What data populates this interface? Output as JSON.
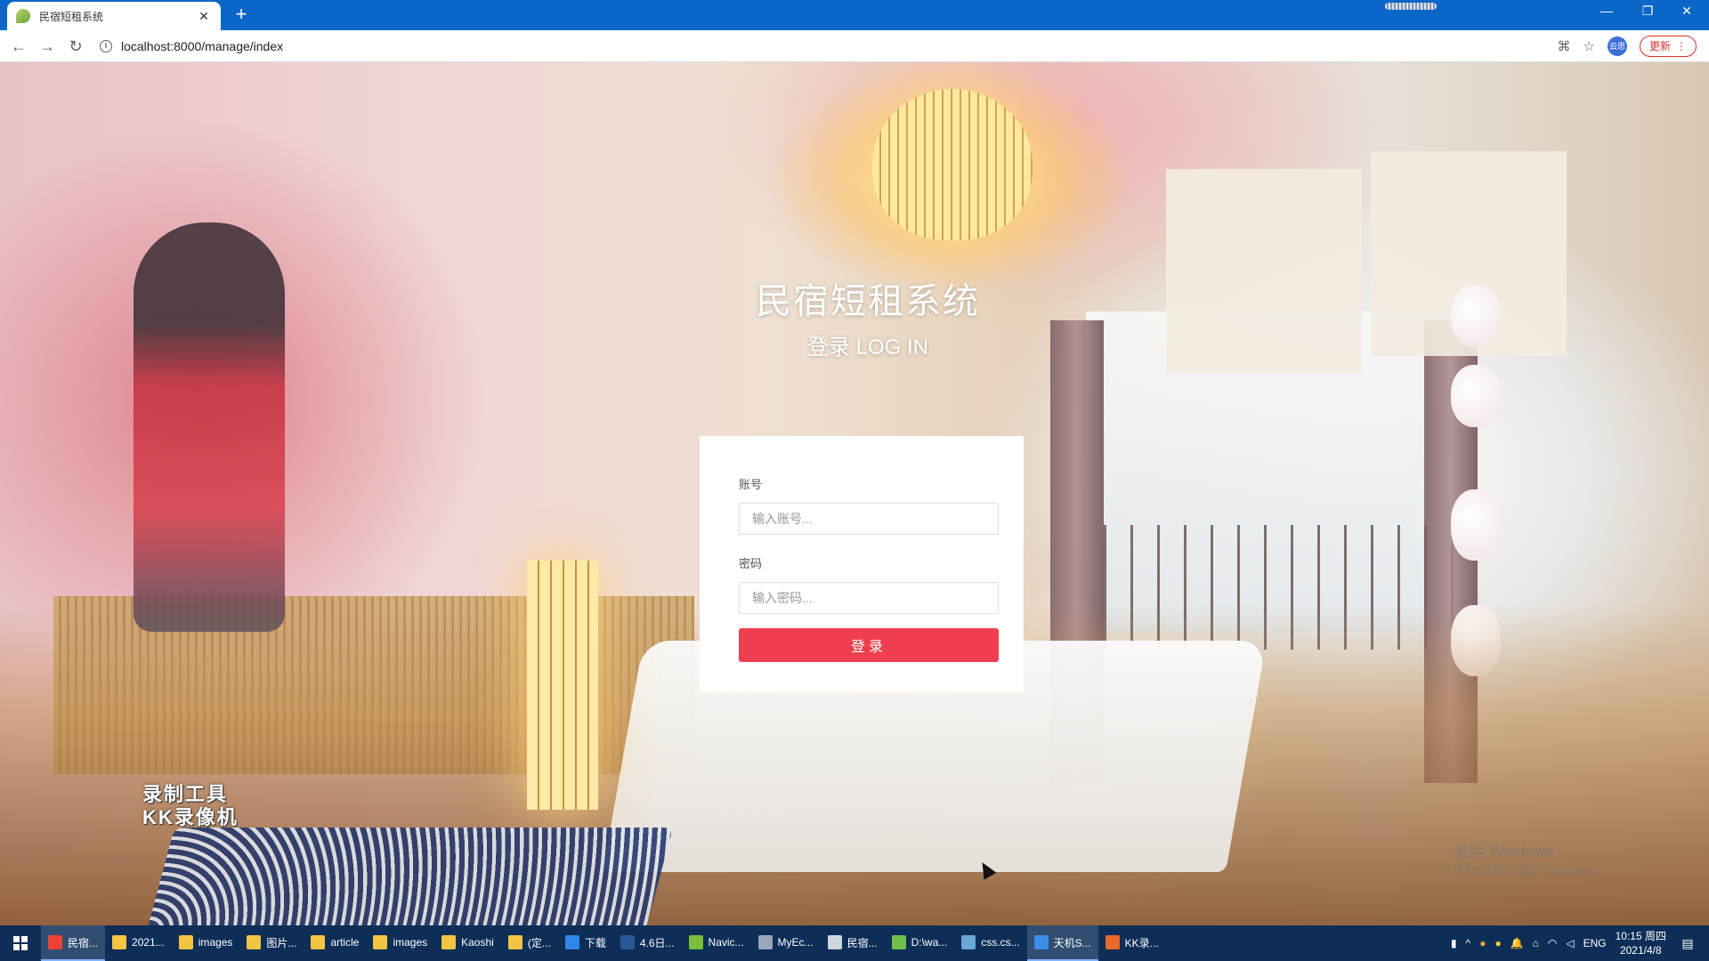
{
  "browser": {
    "tab_title": "民宿短租系统",
    "url": "localhost:8000/manage/index",
    "update_label": "更新",
    "profile_label": "云思"
  },
  "page": {
    "app_title": "民宿短租系统",
    "subtitle": "登录 LOG IN",
    "form": {
      "account_label": "账号",
      "account_placeholder": "输入账号...",
      "password_label": "密码",
      "password_placeholder": "输入密码...",
      "submit_label": "登录"
    },
    "watermark_line1": "录制工具",
    "watermark_line2": "KK录像机",
    "activate_line1": "激活 Windows",
    "activate_line2": "转到\"设置\"以激活 Windows。"
  },
  "taskbar": {
    "items": [
      {
        "label": "民宿...",
        "icon": "chrome-icon",
        "color": "#e94235",
        "active": true
      },
      {
        "label": "2021...",
        "icon": "folder-icon",
        "color": "#f4c542",
        "active": false
      },
      {
        "label": "images",
        "icon": "folder-icon",
        "color": "#f4c542",
        "active": false
      },
      {
        "label": "图片...",
        "icon": "folder-icon",
        "color": "#f4c542",
        "active": false
      },
      {
        "label": "article",
        "icon": "folder-icon",
        "color": "#f4c542",
        "active": false
      },
      {
        "label": "images",
        "icon": "folder-icon",
        "color": "#f4c542",
        "active": false
      },
      {
        "label": "Kaoshi",
        "icon": "folder-icon",
        "color": "#f4c542",
        "active": false
      },
      {
        "label": "(定...",
        "icon": "folder-icon",
        "color": "#f4c542",
        "active": false
      },
      {
        "label": "下载",
        "icon": "download-icon",
        "color": "#2f86e8",
        "active": false
      },
      {
        "label": "4.6日...",
        "icon": "word-icon",
        "color": "#2b5797",
        "active": false
      },
      {
        "label": "Navic...",
        "icon": "navicat-icon",
        "color": "#7bbd3c",
        "active": false
      },
      {
        "label": "MyEc...",
        "icon": "myeclipse-icon",
        "color": "#9aa7b8",
        "active": false
      },
      {
        "label": "民宿...",
        "icon": "wechat-icon",
        "color": "#cfd6dd",
        "active": false
      },
      {
        "label": "D:\\wa...",
        "icon": "notepad-icon",
        "color": "#6fbf4a",
        "active": false
      },
      {
        "label": "css.cs...",
        "icon": "editor-icon",
        "color": "#6aa6d6",
        "active": false
      },
      {
        "label": "天机S...",
        "icon": "tool-icon",
        "color": "#3a8ee6",
        "active": true
      },
      {
        "label": "KK录...",
        "icon": "recorder-icon",
        "color": "#e8692b",
        "active": false
      }
    ],
    "language": "ENG",
    "time": "10:15 周四",
    "date": "2021/4/8"
  }
}
